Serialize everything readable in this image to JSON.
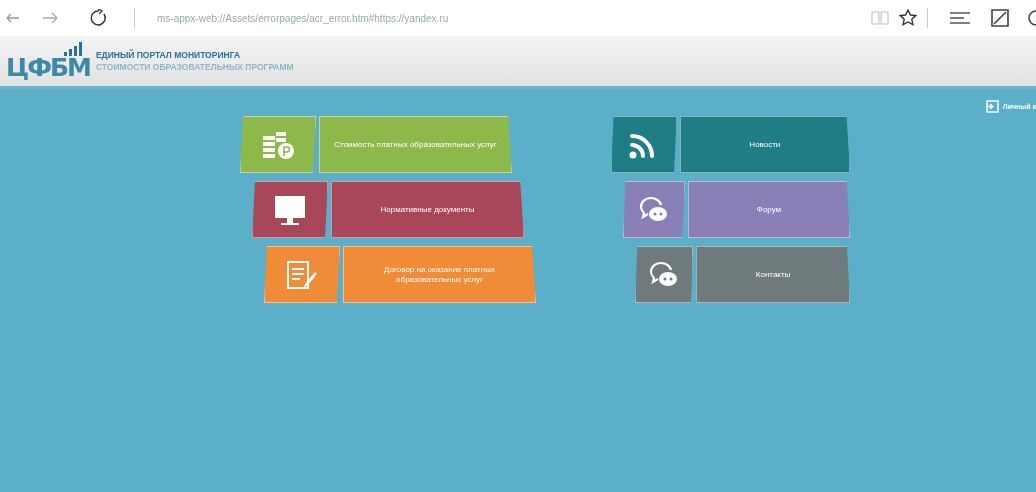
{
  "browser": {
    "url": "ms-appx-web://Assets/errorpages/acr_error.htm#https://yandex.ru"
  },
  "header": {
    "logo": "ЦФБМ",
    "title": "ЕДИНЫЙ ПОРТАЛ МОНИТОРИНГА",
    "subtitle": "СТОИМОСТИ ОБРАЗОВАТЕЛЬНЫХ ПРОГРАММ"
  },
  "account_link": "Личный к",
  "tiles": [
    {
      "label": "Стоимость платных образовательных услуг",
      "color": "#8db84a"
    },
    {
      "label": "Новости",
      "color": "#1f7d86"
    },
    {
      "label": "Нормативные документы",
      "color": "#a8475a"
    },
    {
      "label": "Форум",
      "color": "#8a80b8"
    },
    {
      "label": "Договор на оказание платных образовательных услуг",
      "color": "#f08c38"
    },
    {
      "label": "Контакты",
      "color": "#6e7a7c"
    }
  ]
}
